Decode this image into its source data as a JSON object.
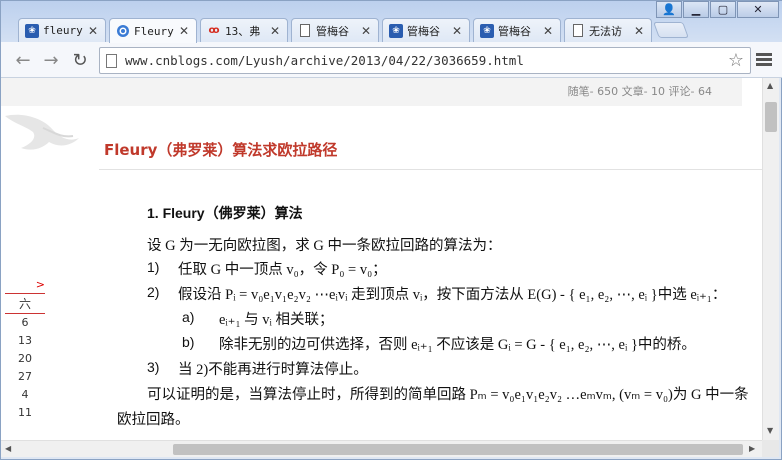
{
  "window": {
    "controls": [
      "user",
      "minimize",
      "maximize",
      "close"
    ]
  },
  "tabs": [
    {
      "label": "fleury",
      "icon": "paw-icon"
    },
    {
      "label": "Fleury",
      "icon": "globe-icon",
      "active": true
    },
    {
      "label": "13、弗",
      "icon": "weibo-icon"
    },
    {
      "label": "管梅谷",
      "icon": "page-icon"
    },
    {
      "label": "管梅谷",
      "icon": "paw-icon"
    },
    {
      "label": "管梅谷",
      "icon": "paw-icon"
    },
    {
      "label": "无法访",
      "icon": "page-icon"
    }
  ],
  "toolbar": {
    "url": "www.cnblogs.com/Lyush/archive/2013/04/22/3036659.html"
  },
  "blog": {
    "stats": "随笔- 650  文章- 10  评论- 64",
    "post_title": "Fleury（弗罗莱）算法求欧拉路径",
    "section_title": "1. Fleury（佛罗莱）算法",
    "intro": "设 G 为一无向欧拉图，求 G 中一条欧拉回路的算法为：",
    "step1_num": "1)",
    "step1": "任取 G 中一顶点 v₀，令 P₀ = v₀；",
    "step2_num": "2)",
    "step2": "假设沿 Pᵢ = v₀e₁v₁e₂v₂ ⋯eᵢvᵢ 走到顶点 vᵢ，按下面方法从 E(G) - { e₁, e₂, ⋯, eᵢ }中选 eᵢ₊₁：",
    "step2a_num": "a)",
    "step2a": "eᵢ₊₁ 与 vᵢ 相关联；",
    "step2b_num": "b)",
    "step2b": "除非无别的边可供选择，否则 eᵢ₊₁ 不应该是 Gᵢ = G - { e₁, e₂, ⋯, eᵢ }中的桥。",
    "step3_num": "3)",
    "step3": "当 2)不能再进行时算法停止。",
    "conclusion1": "可以证明的是，当算法停止时，所得到的简单回路 Pₘ = v₀e₁v₁e₂v₂ …eₘvₘ, (vₘ = v₀)为 G 中一条",
    "conclusion2": "欧拉回路。"
  },
  "calendar": {
    "arrow": ">",
    "header": "六",
    "days": [
      "6",
      "13",
      "20",
      "27",
      "4",
      "11"
    ]
  }
}
